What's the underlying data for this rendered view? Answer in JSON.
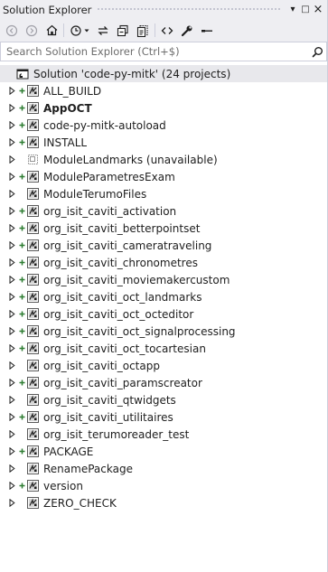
{
  "panel": {
    "title": "Solution Explorer",
    "pin_glyph": "▾",
    "maximize_glyph": "□",
    "close_glyph": "×"
  },
  "search": {
    "placeholder": "Search Solution Explorer (Ctrl+$)"
  },
  "solution": {
    "label": "Solution 'code-py-mitk' (24 projects)"
  },
  "projects": [
    {
      "label": "ALL_BUILD",
      "plus": true,
      "bold": false,
      "unavailable": false
    },
    {
      "label": "AppOCT",
      "plus": true,
      "bold": true,
      "unavailable": false
    },
    {
      "label": "code-py-mitk-autoload",
      "plus": true,
      "bold": false,
      "unavailable": false
    },
    {
      "label": "INSTALL",
      "plus": true,
      "bold": false,
      "unavailable": false
    },
    {
      "label": "ModuleLandmarks (unavailable)",
      "plus": false,
      "bold": false,
      "unavailable": true
    },
    {
      "label": "ModuleParametresExam",
      "plus": true,
      "bold": false,
      "unavailable": false
    },
    {
      "label": "ModuleTerumoFiles",
      "plus": false,
      "bold": false,
      "unavailable": false
    },
    {
      "label": "org_isit_caviti_activation",
      "plus": true,
      "bold": false,
      "unavailable": false
    },
    {
      "label": "org_isit_caviti_betterpointset",
      "plus": true,
      "bold": false,
      "unavailable": false
    },
    {
      "label": "org_isit_caviti_cameratraveling",
      "plus": true,
      "bold": false,
      "unavailable": false
    },
    {
      "label": "org_isit_caviti_chronometres",
      "plus": true,
      "bold": false,
      "unavailable": false
    },
    {
      "label": "org_isit_caviti_moviemakercustom",
      "plus": true,
      "bold": false,
      "unavailable": false
    },
    {
      "label": "org_isit_caviti_oct_landmarks",
      "plus": true,
      "bold": false,
      "unavailable": false
    },
    {
      "label": "org_isit_caviti_oct_octeditor",
      "plus": true,
      "bold": false,
      "unavailable": false
    },
    {
      "label": "org_isit_caviti_oct_signalprocessing",
      "plus": true,
      "bold": false,
      "unavailable": false
    },
    {
      "label": "org_isit_caviti_oct_tocartesian",
      "plus": true,
      "bold": false,
      "unavailable": false
    },
    {
      "label": "org_isit_caviti_octapp",
      "plus": false,
      "bold": false,
      "unavailable": false
    },
    {
      "label": "org_isit_caviti_paramscreator",
      "plus": true,
      "bold": false,
      "unavailable": false
    },
    {
      "label": "org_isit_caviti_qtwidgets",
      "plus": false,
      "bold": false,
      "unavailable": false
    },
    {
      "label": "org_isit_caviti_utilitaires",
      "plus": true,
      "bold": false,
      "unavailable": false
    },
    {
      "label": "org_isit_terumoreader_test",
      "plus": false,
      "bold": false,
      "unavailable": false
    },
    {
      "label": "PACKAGE",
      "plus": true,
      "bold": false,
      "unavailable": false
    },
    {
      "label": "RenamePackage",
      "plus": false,
      "bold": false,
      "unavailable": false
    },
    {
      "label": "version",
      "plus": true,
      "bold": false,
      "unavailable": false
    },
    {
      "label": "ZERO_CHECK",
      "plus": false,
      "bold": false,
      "unavailable": false
    }
  ],
  "colors": {
    "chrome": "#eeeef2",
    "selected_row": "#e8e8ec",
    "plus_green": "#2e7d32",
    "project_icon_border": "#5a5a5a"
  }
}
